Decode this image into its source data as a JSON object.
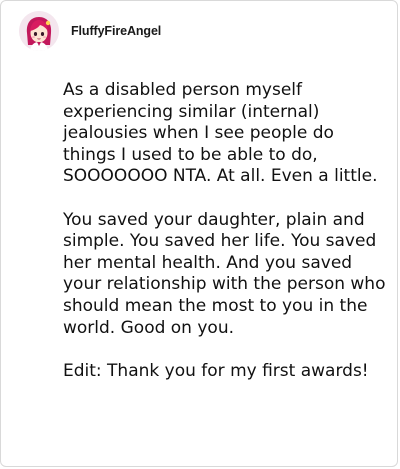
{
  "post": {
    "username": "FluffyFireAngel",
    "avatar_icon": "anime-girl-avatar-icon",
    "paragraphs": [
      "As a disabled person myself experiencing similar (internal) jealousies when I see people do things I used to be able to do, SOOOOOOO NTA. At all. Even a little.",
      "You saved your daughter, plain and simple. You saved her life. You saved her mental health. And you saved your relationship with the person who should mean the most to you in the world. Good on you.",
      "Edit: Thank you for my first awards!"
    ]
  }
}
